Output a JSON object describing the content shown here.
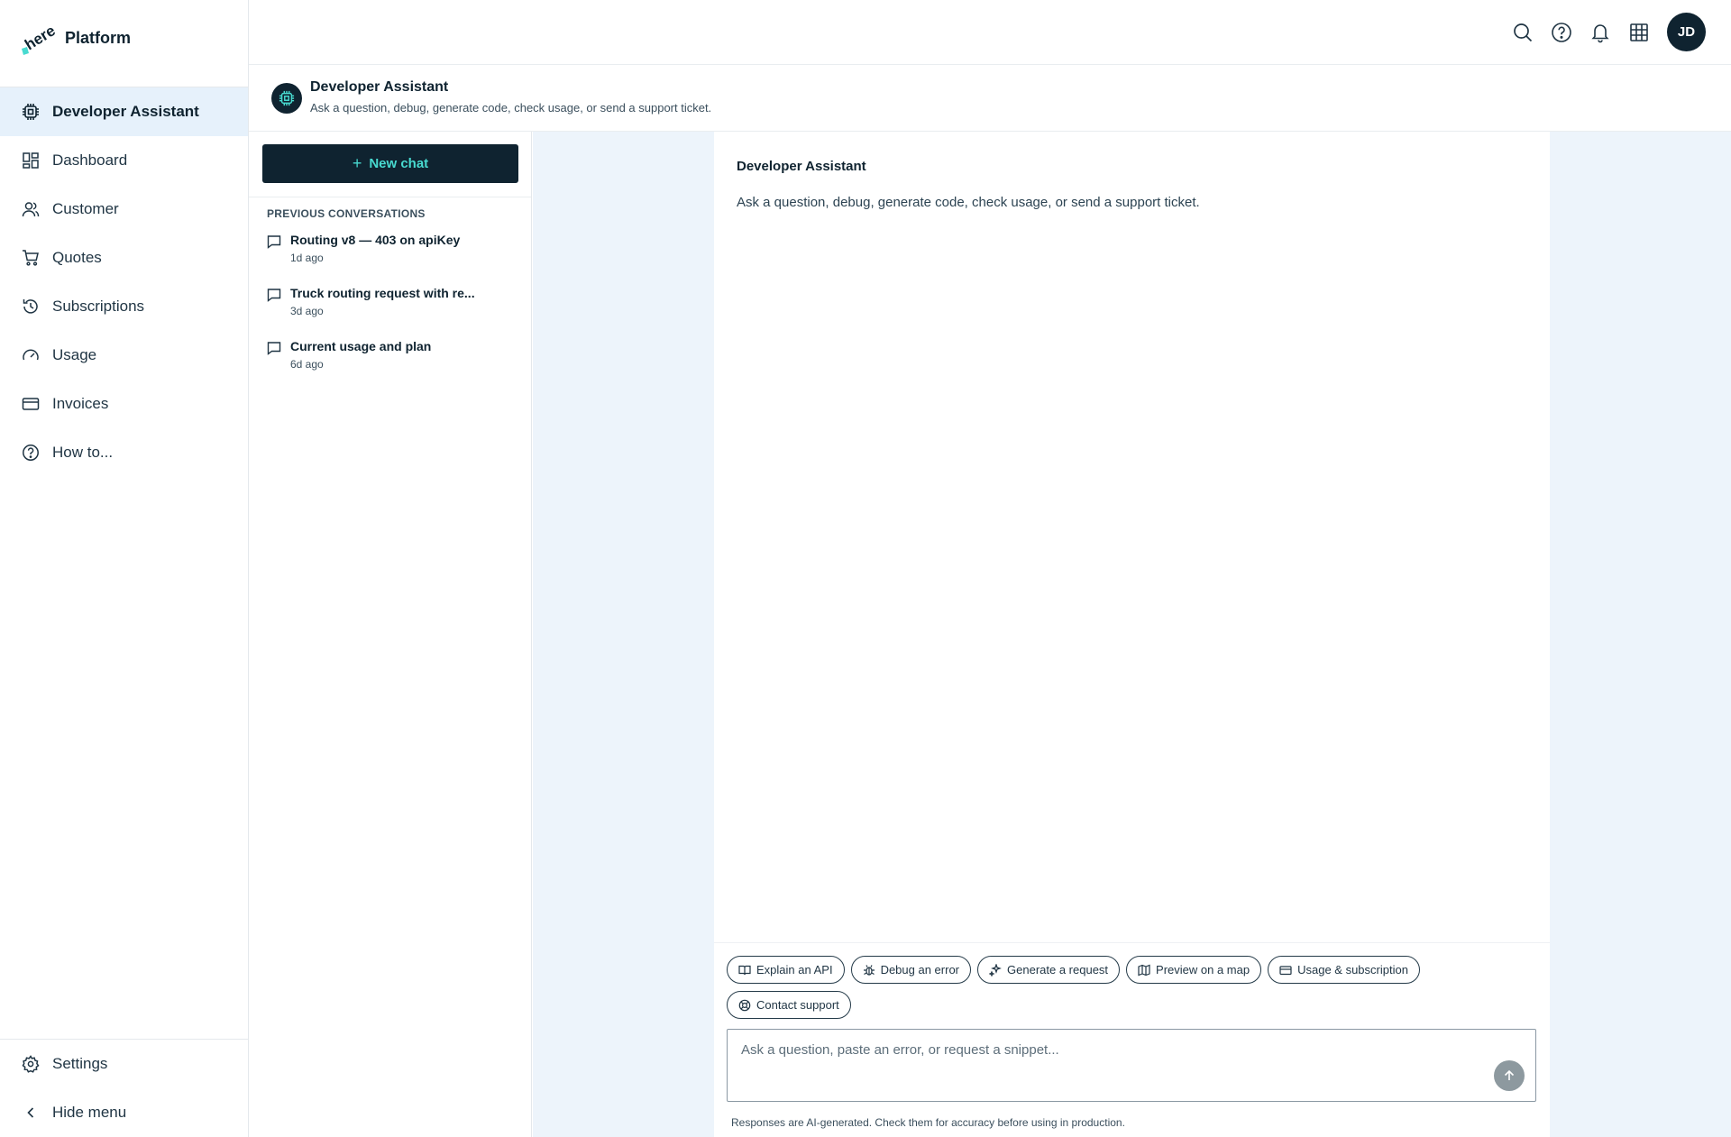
{
  "brand": {
    "name": "Platform",
    "logo_text": "here"
  },
  "sidebar": {
    "items": [
      {
        "label": "Developer Assistant",
        "icon": "chip-icon",
        "active": true
      },
      {
        "label": "Dashboard",
        "icon": "dashboard-icon"
      },
      {
        "label": "Customer",
        "icon": "users-icon"
      },
      {
        "label": "Quotes",
        "icon": "cart-icon"
      },
      {
        "label": "Subscriptions",
        "icon": "history-icon"
      },
      {
        "label": "Usage",
        "icon": "gauge-icon"
      },
      {
        "label": "Invoices",
        "icon": "card-icon"
      },
      {
        "label": "How to...",
        "icon": "help-icon"
      }
    ],
    "bottom": [
      {
        "label": "Settings",
        "icon": "gear-icon"
      },
      {
        "label": "Hide menu",
        "icon": "chevron-left-icon"
      }
    ]
  },
  "topbar": {
    "avatar_initials": "JD"
  },
  "header": {
    "title": "Developer Assistant",
    "subtitle": "Ask a question, debug, generate code, check usage, or send a support ticket."
  },
  "conversations": {
    "new_chat_label": "New chat",
    "section_label": "PREVIOUS CONVERSATIONS",
    "items": [
      {
        "title": "Routing v8 — 403 on apiKey",
        "time": "1d ago"
      },
      {
        "title": "Truck routing request with re...",
        "time": "3d ago"
      },
      {
        "title": "Current usage and plan",
        "time": "6d ago"
      }
    ]
  },
  "chat": {
    "title": "Developer Assistant",
    "subtitle": "Ask a question, debug, generate code, check usage, or send a support ticket.",
    "chips": [
      {
        "label": "Explain an API",
        "icon": "book-icon"
      },
      {
        "label": "Debug an error",
        "icon": "bug-icon"
      },
      {
        "label": "Generate a request",
        "icon": "sparkle-icon"
      },
      {
        "label": "Preview on a map",
        "icon": "map-icon"
      },
      {
        "label": "Usage & subscription",
        "icon": "card-icon"
      },
      {
        "label": "Contact support",
        "icon": "lifebuoy-icon"
      }
    ],
    "input_placeholder": "Ask a question, paste an error, or request a snippet...",
    "input_value": "",
    "disclaimer": "Responses are AI-generated. Check them for accuracy before using in production."
  },
  "colors": {
    "primary_dark": "#0f2330",
    "accent_teal": "#48dad0",
    "active_bg": "#e6f1fb",
    "chat_bg": "#edf4fb",
    "send_disabled": "#8d999f"
  }
}
